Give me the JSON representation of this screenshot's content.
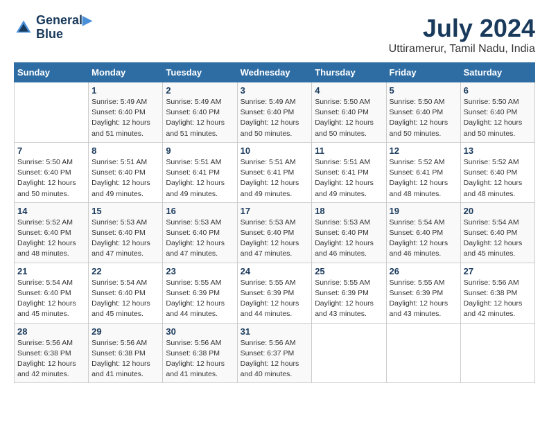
{
  "header": {
    "logo_line1": "General",
    "logo_line2": "Blue",
    "month_year": "July 2024",
    "location": "Uttiramerur, Tamil Nadu, India"
  },
  "days_of_week": [
    "Sunday",
    "Monday",
    "Tuesday",
    "Wednesday",
    "Thursday",
    "Friday",
    "Saturday"
  ],
  "weeks": [
    [
      {
        "day": "",
        "info": ""
      },
      {
        "day": "1",
        "info": "Sunrise: 5:49 AM\nSunset: 6:40 PM\nDaylight: 12 hours\nand 51 minutes."
      },
      {
        "day": "2",
        "info": "Sunrise: 5:49 AM\nSunset: 6:40 PM\nDaylight: 12 hours\nand 51 minutes."
      },
      {
        "day": "3",
        "info": "Sunrise: 5:49 AM\nSunset: 6:40 PM\nDaylight: 12 hours\nand 50 minutes."
      },
      {
        "day": "4",
        "info": "Sunrise: 5:50 AM\nSunset: 6:40 PM\nDaylight: 12 hours\nand 50 minutes."
      },
      {
        "day": "5",
        "info": "Sunrise: 5:50 AM\nSunset: 6:40 PM\nDaylight: 12 hours\nand 50 minutes."
      },
      {
        "day": "6",
        "info": "Sunrise: 5:50 AM\nSunset: 6:40 PM\nDaylight: 12 hours\nand 50 minutes."
      }
    ],
    [
      {
        "day": "7",
        "info": "Sunrise: 5:50 AM\nSunset: 6:40 PM\nDaylight: 12 hours\nand 50 minutes."
      },
      {
        "day": "8",
        "info": "Sunrise: 5:51 AM\nSunset: 6:40 PM\nDaylight: 12 hours\nand 49 minutes."
      },
      {
        "day": "9",
        "info": "Sunrise: 5:51 AM\nSunset: 6:41 PM\nDaylight: 12 hours\nand 49 minutes."
      },
      {
        "day": "10",
        "info": "Sunrise: 5:51 AM\nSunset: 6:41 PM\nDaylight: 12 hours\nand 49 minutes."
      },
      {
        "day": "11",
        "info": "Sunrise: 5:51 AM\nSunset: 6:41 PM\nDaylight: 12 hours\nand 49 minutes."
      },
      {
        "day": "12",
        "info": "Sunrise: 5:52 AM\nSunset: 6:41 PM\nDaylight: 12 hours\nand 48 minutes."
      },
      {
        "day": "13",
        "info": "Sunrise: 5:52 AM\nSunset: 6:40 PM\nDaylight: 12 hours\nand 48 minutes."
      }
    ],
    [
      {
        "day": "14",
        "info": "Sunrise: 5:52 AM\nSunset: 6:40 PM\nDaylight: 12 hours\nand 48 minutes."
      },
      {
        "day": "15",
        "info": "Sunrise: 5:53 AM\nSunset: 6:40 PM\nDaylight: 12 hours\nand 47 minutes."
      },
      {
        "day": "16",
        "info": "Sunrise: 5:53 AM\nSunset: 6:40 PM\nDaylight: 12 hours\nand 47 minutes."
      },
      {
        "day": "17",
        "info": "Sunrise: 5:53 AM\nSunset: 6:40 PM\nDaylight: 12 hours\nand 47 minutes."
      },
      {
        "day": "18",
        "info": "Sunrise: 5:53 AM\nSunset: 6:40 PM\nDaylight: 12 hours\nand 46 minutes."
      },
      {
        "day": "19",
        "info": "Sunrise: 5:54 AM\nSunset: 6:40 PM\nDaylight: 12 hours\nand 46 minutes."
      },
      {
        "day": "20",
        "info": "Sunrise: 5:54 AM\nSunset: 6:40 PM\nDaylight: 12 hours\nand 45 minutes."
      }
    ],
    [
      {
        "day": "21",
        "info": "Sunrise: 5:54 AM\nSunset: 6:40 PM\nDaylight: 12 hours\nand 45 minutes."
      },
      {
        "day": "22",
        "info": "Sunrise: 5:54 AM\nSunset: 6:40 PM\nDaylight: 12 hours\nand 45 minutes."
      },
      {
        "day": "23",
        "info": "Sunrise: 5:55 AM\nSunset: 6:39 PM\nDaylight: 12 hours\nand 44 minutes."
      },
      {
        "day": "24",
        "info": "Sunrise: 5:55 AM\nSunset: 6:39 PM\nDaylight: 12 hours\nand 44 minutes."
      },
      {
        "day": "25",
        "info": "Sunrise: 5:55 AM\nSunset: 6:39 PM\nDaylight: 12 hours\nand 43 minutes."
      },
      {
        "day": "26",
        "info": "Sunrise: 5:55 AM\nSunset: 6:39 PM\nDaylight: 12 hours\nand 43 minutes."
      },
      {
        "day": "27",
        "info": "Sunrise: 5:56 AM\nSunset: 6:38 PM\nDaylight: 12 hours\nand 42 minutes."
      }
    ],
    [
      {
        "day": "28",
        "info": "Sunrise: 5:56 AM\nSunset: 6:38 PM\nDaylight: 12 hours\nand 42 minutes."
      },
      {
        "day": "29",
        "info": "Sunrise: 5:56 AM\nSunset: 6:38 PM\nDaylight: 12 hours\nand 41 minutes."
      },
      {
        "day": "30",
        "info": "Sunrise: 5:56 AM\nSunset: 6:38 PM\nDaylight: 12 hours\nand 41 minutes."
      },
      {
        "day": "31",
        "info": "Sunrise: 5:56 AM\nSunset: 6:37 PM\nDaylight: 12 hours\nand 40 minutes."
      },
      {
        "day": "",
        "info": ""
      },
      {
        "day": "",
        "info": ""
      },
      {
        "day": "",
        "info": ""
      }
    ]
  ]
}
